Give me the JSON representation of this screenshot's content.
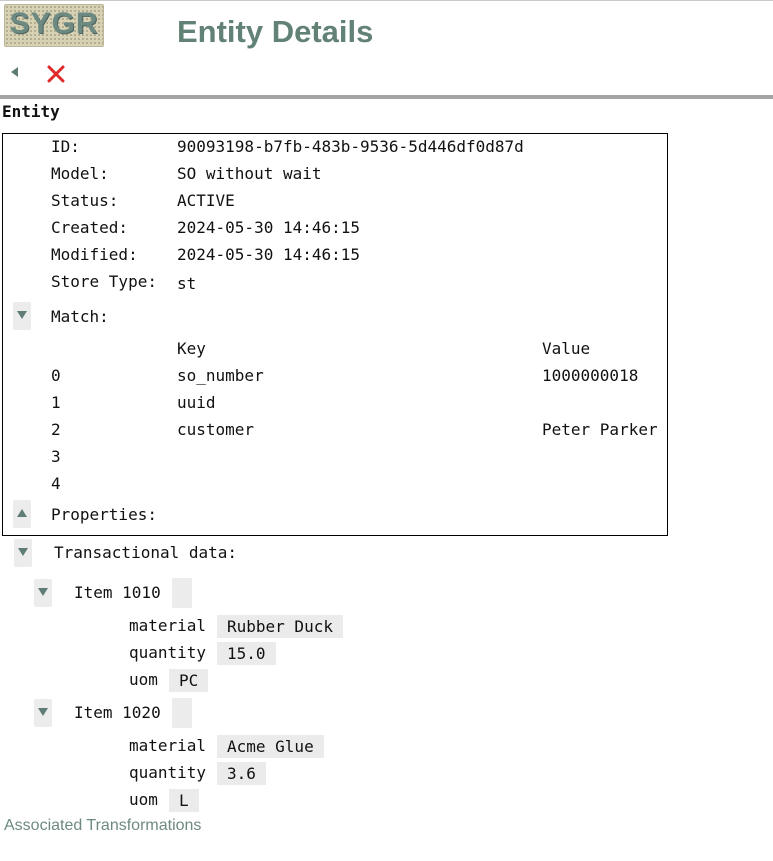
{
  "header": {
    "logo_text": "SYGR",
    "title": "Entity Details"
  },
  "toolbar": {
    "back_icon": "back-arrow-icon",
    "close_icon": "close-icon",
    "close_color": "#e02a2a"
  },
  "section_label": "Entity",
  "entity": {
    "fields": [
      {
        "label": "ID:",
        "value": "90093198-b7fb-483b-9536-5d446df0d87d"
      },
      {
        "label": "Model:",
        "value": "SO without wait"
      },
      {
        "label": "Status:",
        "value": "ACTIVE"
      },
      {
        "label": "Created:",
        "value": "2024-05-30 14:46:15"
      },
      {
        "label": "Modified:",
        "value": "2024-05-30 14:46:15"
      },
      {
        "label": "Store Type:",
        "value": "st"
      }
    ],
    "match": {
      "label": "Match:",
      "expanded": true,
      "headers": {
        "key": "Key",
        "value": "Value"
      },
      "rows": [
        {
          "index": "0",
          "key": "so_number",
          "value": "1000000018"
        },
        {
          "index": "1",
          "key": "uuid",
          "value": ""
        },
        {
          "index": "2",
          "key": "customer",
          "value": "Peter Parker"
        },
        {
          "index": "3",
          "key": "",
          "value": ""
        },
        {
          "index": "4",
          "key": "",
          "value": ""
        }
      ]
    },
    "properties": {
      "label": "Properties:",
      "expanded": false
    }
  },
  "transactional": {
    "label": "Transactional data:",
    "items": [
      {
        "title": "Item 1010",
        "fields": [
          {
            "label": "material",
            "value": "Rubber Duck"
          },
          {
            "label": "quantity",
            "value": "15.0"
          },
          {
            "label": "uom",
            "value": "PC"
          }
        ]
      },
      {
        "title": "Item 1020",
        "fields": [
          {
            "label": "material",
            "value": "Acme Glue"
          },
          {
            "label": "quantity",
            "value": "3.6"
          },
          {
            "label": "uom",
            "value": "L"
          }
        ]
      }
    ]
  },
  "footer": {
    "link": "Associated Transformations"
  },
  "colors": {
    "accent": "#628276",
    "toggle_arrow": "#5f7d76",
    "chip_bg": "#ebebeb"
  }
}
